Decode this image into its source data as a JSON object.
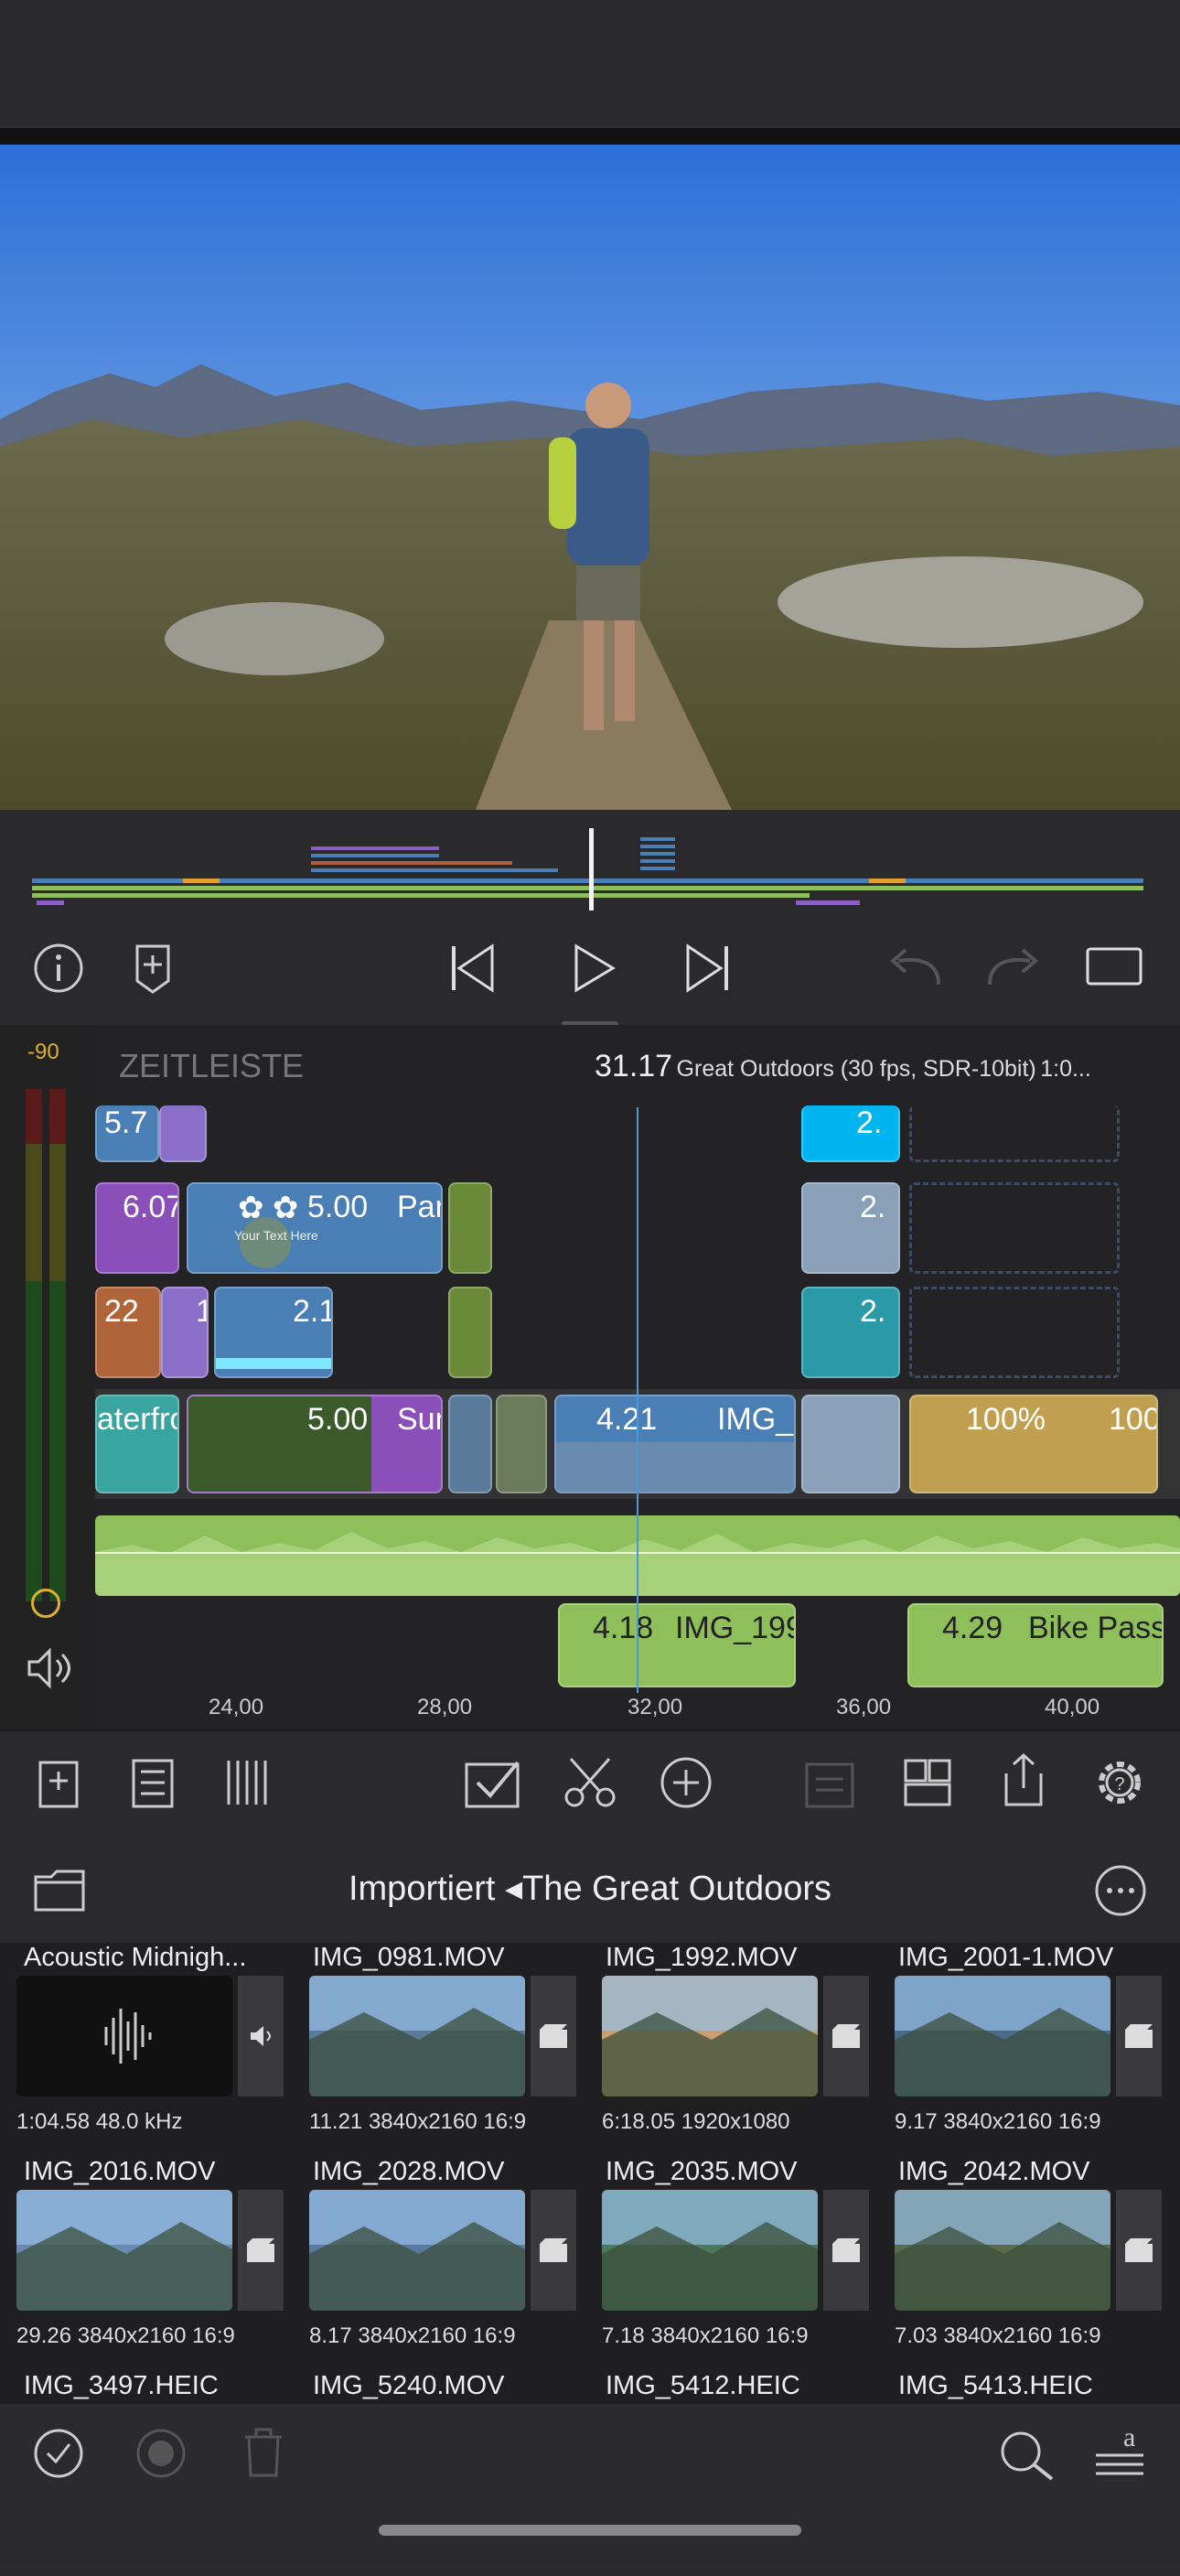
{
  "meter": {
    "peak_label": "-90"
  },
  "timeline": {
    "title": "ZEITLEISTE",
    "time": "31.17",
    "project": "Great Outdoors (30 fps, SDR-10bit)",
    "duration": "1:0...",
    "ruler": [
      "24,00",
      "28,00",
      "32,00",
      "36,00",
      "40,00"
    ],
    "clips": {
      "track1_a": "5.7",
      "track1_b": "2.",
      "track2_a": "6.07",
      "track2_b_dur": "5.00",
      "track2_b_name": "Par",
      "track2_overlay": "Your Text Here",
      "track2_c": "2.",
      "track3_a": "22",
      "track3_b": "1",
      "track3_c": "2.1",
      "track3_d": "2.",
      "main_a": "aterfro",
      "main_b_dur": "5.00",
      "main_b_name": "Sur",
      "main_c_dur": "4.21",
      "main_c_name": "IMG_",
      "main_d_speed": "100%",
      "main_d_speed2": "100",
      "audio2_a_dur": "4.18",
      "audio2_a_name": "IMG_199",
      "audio2_b_dur": "4.29",
      "audio2_b_name": "Bike Pass"
    }
  },
  "browser": {
    "path_root": "Importiert",
    "path_current": "The Great Outdoors",
    "items": [
      {
        "name": "Acoustic Midnigh...",
        "meta": "1:04.58  48.0 kHz",
        "kind": "audio"
      },
      {
        "name": "IMG_0981.MOV",
        "meta": "11.21  3840x2160  16:9",
        "kind": "video"
      },
      {
        "name": "IMG_1992.MOV",
        "meta": "6:18.05  1920x1080",
        "kind": "video"
      },
      {
        "name": "IMG_2001-1.MOV",
        "meta": "9.17  3840x2160  16:9",
        "kind": "video"
      },
      {
        "name": "IMG_2016.MOV",
        "meta": "29.26  3840x2160  16:9",
        "kind": "video"
      },
      {
        "name": "IMG_2028.MOV",
        "meta": "8.17  3840x2160  16:9",
        "kind": "video"
      },
      {
        "name": "IMG_2035.MOV",
        "meta": "7.18  3840x2160  16:9",
        "kind": "video"
      },
      {
        "name": "IMG_2042.MOV",
        "meta": "7.03  3840x2160  16:9",
        "kind": "video"
      },
      {
        "name": "IMG_3497.HEIC",
        "meta": "",
        "kind": "photo"
      },
      {
        "name": "IMG_5240.MOV",
        "meta": "",
        "kind": "video"
      },
      {
        "name": "IMG_5412.HEIC",
        "meta": "",
        "kind": "photo"
      },
      {
        "name": "IMG_5413.HEIC",
        "meta": "",
        "kind": "photo"
      }
    ]
  },
  "colors": {
    "accent_blue": "#4a7fb5",
    "clip_purple": "#8a5fc0",
    "audio_green": "#8fbf5a",
    "meter_yellow": "#e0b030"
  }
}
